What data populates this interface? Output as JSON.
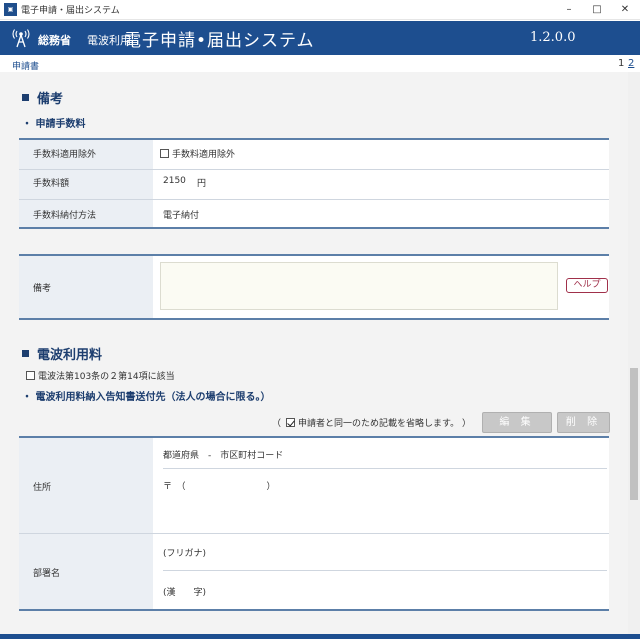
{
  "window": {
    "title": "電子申請・届出システム",
    "minimize": "–",
    "maximize": "□",
    "close": "✕",
    "app_icon": "app-icon"
  },
  "header": {
    "ministry": "総務省",
    "usage": "電波利用",
    "title": "電子申請•届出システム",
    "version": "1.2.0.0",
    "icon": "antenna-icon"
  },
  "subbar": {
    "doc_label": "申請書",
    "pages": [
      "1",
      "2"
    ]
  },
  "remarks_section": {
    "title": "備考",
    "fee_subtitle": "・ 申請手数料",
    "fee_exempt_label": "手数料適用除外",
    "fee_exempt_checkbox": "手数料適用除外",
    "fee_amount_label": "手数料額",
    "fee_amount_value": "2150",
    "fee_amount_unit": "円",
    "fee_method_label": "手数料納付方法",
    "fee_method_value": "電子納付",
    "remarks_label": "備考",
    "remarks_value": "",
    "help_button": "ヘルプ"
  },
  "radio_fee_section": {
    "title": "電波利用料",
    "article_checkbox": "電波法第103条の２第14項に該当",
    "notice_subtitle": "・ 電波利用料納入告知書送付先（法人の場合に限る。）",
    "omit_open": "（",
    "omit_checkbox": "申請者と同一のため記載を省略します。",
    "omit_close": "）",
    "edit_button": "編 集",
    "delete_button": "削 除",
    "address_label": "住所",
    "prefecture_text": "都道府県　-　市区町村コード",
    "postal_text": "〒　（　　　　　　　　　）",
    "dept_label": "部署名",
    "furigana_text": "(フリガナ)",
    "kanji_text": "(漢　　字)"
  }
}
